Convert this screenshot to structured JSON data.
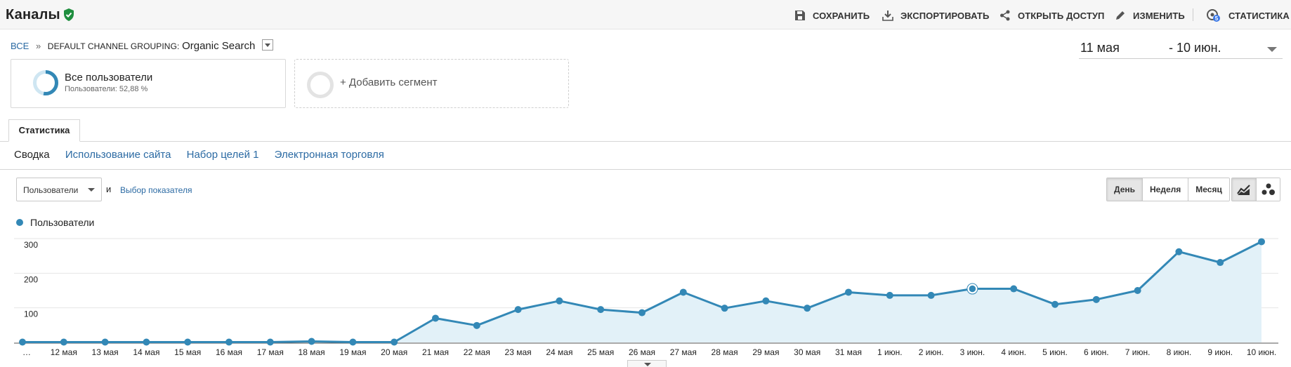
{
  "header": {
    "title": "Каналы",
    "actions": [
      {
        "label": "СОХРАНИТЬ",
        "icon": "save-icon"
      },
      {
        "label": "ЭКСПОРТИРОВАТЬ",
        "icon": "download-icon"
      },
      {
        "label": "ОТКРЫТЬ ДОСТУП",
        "icon": "share-icon"
      },
      {
        "label": "ИЗМЕНИТЬ",
        "icon": "pencil-icon"
      },
      {
        "label": "СТАТИСТИКА",
        "icon": "insights-icon",
        "badge": "5"
      }
    ]
  },
  "breadcrumb": {
    "all": "ВСЕ",
    "separator": "»",
    "group": "DEFAULT CHANNEL GROUPING:",
    "value": "Organic Search"
  },
  "date_range": {
    "start": "11 мая",
    "end": "- 10 июн."
  },
  "segments": {
    "active": {
      "title": "Все пользователи",
      "subtitle": "Пользователи: 52,88 %",
      "percent": 52.88
    },
    "add_label": "+ Добавить сегмент"
  },
  "tabs": {
    "main": "Статистика"
  },
  "subtabs": [
    "Сводка",
    "Использование сайта",
    "Набор целей 1",
    "Электронная торговля"
  ],
  "controls": {
    "metric": "Пользователи",
    "and": "и",
    "choose_metric": "Выбор показателя",
    "periods": [
      "День",
      "Неделя",
      "Месяц"
    ],
    "active_period": "День"
  },
  "legend": {
    "label": "Пользователи"
  },
  "colors": {
    "accent": "#3388b6",
    "fill": "#e2f1f8",
    "link": "#2b6aa3",
    "verified": "#1e8e3e"
  },
  "chart_data": {
    "type": "area",
    "x": [
      "…",
      "12 мая",
      "13 мая",
      "14 мая",
      "15 мая",
      "16 мая",
      "17 мая",
      "18 мая",
      "19 мая",
      "20 мая",
      "21 мая",
      "22 мая",
      "23 мая",
      "24 мая",
      "25 мая",
      "26 мая",
      "27 мая",
      "28 мая",
      "29 мая",
      "30 мая",
      "31 мая",
      "1 июн.",
      "2 июн.",
      "3 июн.",
      "4 июн.",
      "5 июн.",
      "6 июн.",
      "7 июн.",
      "8 июн.",
      "9 июн.",
      "10 июн."
    ],
    "series": [
      {
        "name": "Пользователи",
        "values": [
          1,
          1,
          1,
          1,
          1,
          1,
          1,
          3,
          1,
          1,
          70,
          49,
          95,
          120,
          95,
          86,
          145,
          99,
          120,
          99,
          145,
          136,
          136,
          155,
          155,
          110,
          124,
          150,
          262,
          231,
          291
        ]
      }
    ],
    "yticks": [
      100,
      200,
      300
    ],
    "ylim": [
      0,
      300
    ],
    "highlight_index": 23,
    "grid": true
  }
}
